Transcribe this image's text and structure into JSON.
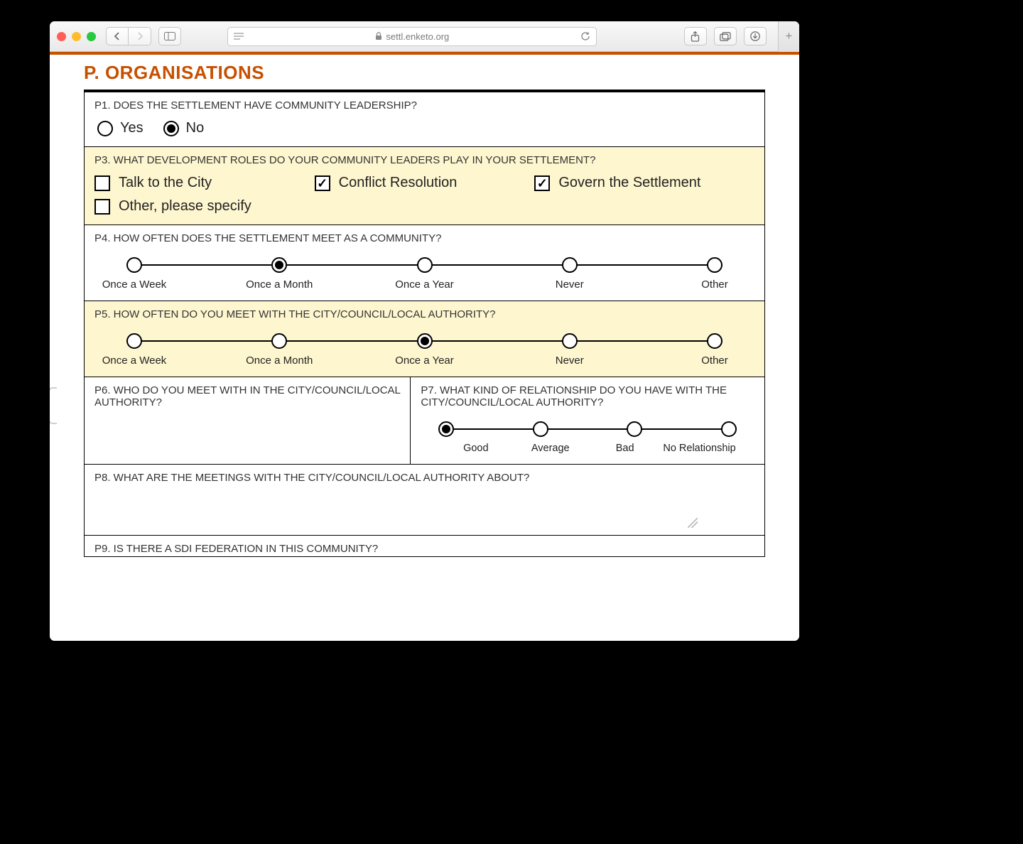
{
  "browser": {
    "url_host": "settl.enketo.org"
  },
  "section_title": "P. ORGANISATIONS",
  "p1": {
    "label": "P1. DOES THE SETTLEMENT HAVE COMMUNITY LEADERSHIP?",
    "yes": "Yes",
    "no": "No",
    "selected": "no"
  },
  "p3": {
    "label": "P3. WHAT DEVELOPMENT ROLES DO YOUR COMMUNITY LEADERS PLAY IN YOUR SETTLEMENT?",
    "options": [
      {
        "label": "Talk to the City",
        "checked": false
      },
      {
        "label": "Conflict Resolution",
        "checked": true
      },
      {
        "label": "Govern the Settlement",
        "checked": true
      },
      {
        "label": "Other, please specify",
        "checked": false
      }
    ]
  },
  "p4": {
    "label": "P4. HOW OFTEN DOES THE SETTLEMENT MEET AS A COMMUNITY?",
    "options": [
      "Once a Week",
      "Once a Month",
      "Once a Year",
      "Never",
      "Other"
    ],
    "selected_index": 1
  },
  "p5": {
    "label": "P5. HOW OFTEN DO YOU MEET WITH THE CITY/COUNCIL/LOCAL AUTHORITY?",
    "options": [
      "Once a Week",
      "Once a Month",
      "Once a Year",
      "Never",
      "Other"
    ],
    "selected_index": 2
  },
  "p6": {
    "label": "P6. WHO DO YOU MEET WITH IN THE CITY/COUNCIL/LOCAL AUTHORITY?"
  },
  "p7": {
    "label": "P7. WHAT KIND OF RELATIONSHIP DO YOU HAVE WITH THE CITY/COUNCIL/LOCAL AUTHORITY?",
    "options": [
      "Good",
      "Average",
      "Bad",
      "No Relationship"
    ],
    "selected_index": 0
  },
  "p8": {
    "label": "P8. WHAT ARE THE MEETINGS WITH THE CITY/COUNCIL/LOCAL AUTHORITY ABOUT?"
  },
  "p9": {
    "label": "P9. IS THERE A SDI FEDERATION IN THIS COMMUNITY?"
  }
}
